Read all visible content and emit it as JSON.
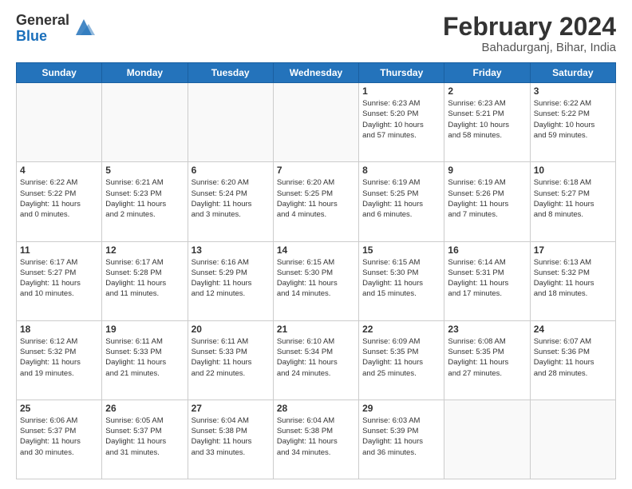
{
  "header": {
    "logo_general": "General",
    "logo_blue": "Blue",
    "main_title": "February 2024",
    "subtitle": "Bahadurganj, Bihar, India"
  },
  "calendar": {
    "days_of_week": [
      "Sunday",
      "Monday",
      "Tuesday",
      "Wednesday",
      "Thursday",
      "Friday",
      "Saturday"
    ],
    "weeks": [
      [
        {
          "day": "",
          "info": ""
        },
        {
          "day": "",
          "info": ""
        },
        {
          "day": "",
          "info": ""
        },
        {
          "day": "",
          "info": ""
        },
        {
          "day": "1",
          "info": "Sunrise: 6:23 AM\nSunset: 5:20 PM\nDaylight: 10 hours\nand 57 minutes."
        },
        {
          "day": "2",
          "info": "Sunrise: 6:23 AM\nSunset: 5:21 PM\nDaylight: 10 hours\nand 58 minutes."
        },
        {
          "day": "3",
          "info": "Sunrise: 6:22 AM\nSunset: 5:22 PM\nDaylight: 10 hours\nand 59 minutes."
        }
      ],
      [
        {
          "day": "4",
          "info": "Sunrise: 6:22 AM\nSunset: 5:22 PM\nDaylight: 11 hours\nand 0 minutes."
        },
        {
          "day": "5",
          "info": "Sunrise: 6:21 AM\nSunset: 5:23 PM\nDaylight: 11 hours\nand 2 minutes."
        },
        {
          "day": "6",
          "info": "Sunrise: 6:20 AM\nSunset: 5:24 PM\nDaylight: 11 hours\nand 3 minutes."
        },
        {
          "day": "7",
          "info": "Sunrise: 6:20 AM\nSunset: 5:25 PM\nDaylight: 11 hours\nand 4 minutes."
        },
        {
          "day": "8",
          "info": "Sunrise: 6:19 AM\nSunset: 5:25 PM\nDaylight: 11 hours\nand 6 minutes."
        },
        {
          "day": "9",
          "info": "Sunrise: 6:19 AM\nSunset: 5:26 PM\nDaylight: 11 hours\nand 7 minutes."
        },
        {
          "day": "10",
          "info": "Sunrise: 6:18 AM\nSunset: 5:27 PM\nDaylight: 11 hours\nand 8 minutes."
        }
      ],
      [
        {
          "day": "11",
          "info": "Sunrise: 6:17 AM\nSunset: 5:27 PM\nDaylight: 11 hours\nand 10 minutes."
        },
        {
          "day": "12",
          "info": "Sunrise: 6:17 AM\nSunset: 5:28 PM\nDaylight: 11 hours\nand 11 minutes."
        },
        {
          "day": "13",
          "info": "Sunrise: 6:16 AM\nSunset: 5:29 PM\nDaylight: 11 hours\nand 12 minutes."
        },
        {
          "day": "14",
          "info": "Sunrise: 6:15 AM\nSunset: 5:30 PM\nDaylight: 11 hours\nand 14 minutes."
        },
        {
          "day": "15",
          "info": "Sunrise: 6:15 AM\nSunset: 5:30 PM\nDaylight: 11 hours\nand 15 minutes."
        },
        {
          "day": "16",
          "info": "Sunrise: 6:14 AM\nSunset: 5:31 PM\nDaylight: 11 hours\nand 17 minutes."
        },
        {
          "day": "17",
          "info": "Sunrise: 6:13 AM\nSunset: 5:32 PM\nDaylight: 11 hours\nand 18 minutes."
        }
      ],
      [
        {
          "day": "18",
          "info": "Sunrise: 6:12 AM\nSunset: 5:32 PM\nDaylight: 11 hours\nand 19 minutes."
        },
        {
          "day": "19",
          "info": "Sunrise: 6:11 AM\nSunset: 5:33 PM\nDaylight: 11 hours\nand 21 minutes."
        },
        {
          "day": "20",
          "info": "Sunrise: 6:11 AM\nSunset: 5:33 PM\nDaylight: 11 hours\nand 22 minutes."
        },
        {
          "day": "21",
          "info": "Sunrise: 6:10 AM\nSunset: 5:34 PM\nDaylight: 11 hours\nand 24 minutes."
        },
        {
          "day": "22",
          "info": "Sunrise: 6:09 AM\nSunset: 5:35 PM\nDaylight: 11 hours\nand 25 minutes."
        },
        {
          "day": "23",
          "info": "Sunrise: 6:08 AM\nSunset: 5:35 PM\nDaylight: 11 hours\nand 27 minutes."
        },
        {
          "day": "24",
          "info": "Sunrise: 6:07 AM\nSunset: 5:36 PM\nDaylight: 11 hours\nand 28 minutes."
        }
      ],
      [
        {
          "day": "25",
          "info": "Sunrise: 6:06 AM\nSunset: 5:37 PM\nDaylight: 11 hours\nand 30 minutes."
        },
        {
          "day": "26",
          "info": "Sunrise: 6:05 AM\nSunset: 5:37 PM\nDaylight: 11 hours\nand 31 minutes."
        },
        {
          "day": "27",
          "info": "Sunrise: 6:04 AM\nSunset: 5:38 PM\nDaylight: 11 hours\nand 33 minutes."
        },
        {
          "day": "28",
          "info": "Sunrise: 6:04 AM\nSunset: 5:38 PM\nDaylight: 11 hours\nand 34 minutes."
        },
        {
          "day": "29",
          "info": "Sunrise: 6:03 AM\nSunset: 5:39 PM\nDaylight: 11 hours\nand 36 minutes."
        },
        {
          "day": "",
          "info": ""
        },
        {
          "day": "",
          "info": ""
        }
      ]
    ]
  }
}
